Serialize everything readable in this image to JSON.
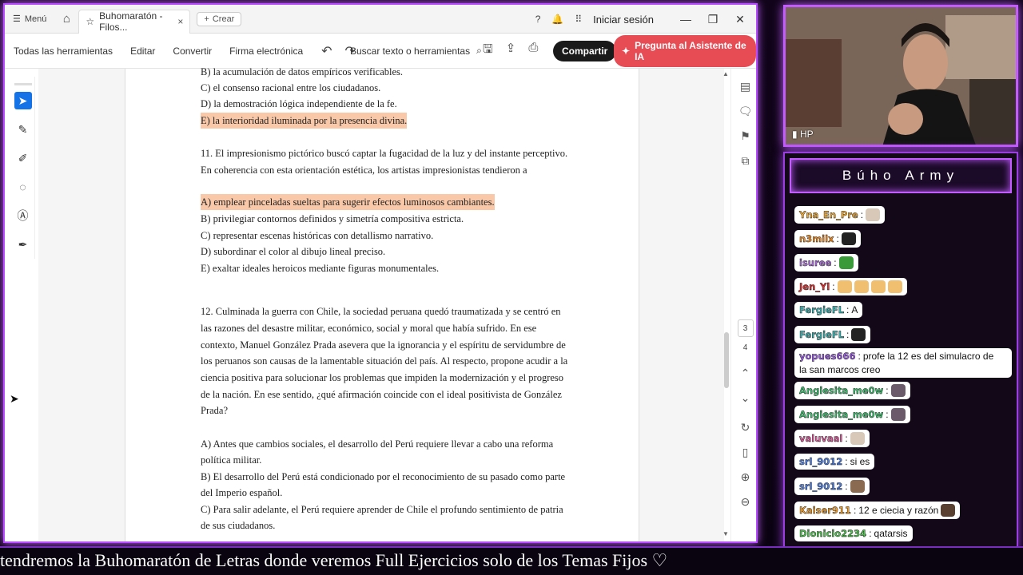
{
  "titlebar": {
    "menu_label": "Menú",
    "tab_label": "Buhomaratón - Filos...",
    "new_tab_label": "Crear",
    "signin_label": "Iniciar sesión"
  },
  "toolbar": {
    "all_tools": "Todas las herramientas",
    "edit": "Editar",
    "convert": "Convertir",
    "esign": "Firma electrónica",
    "search": "Buscar texto o herramientas",
    "share": "Compartir",
    "ai": "Pregunta al Asistente de IA"
  },
  "document": {
    "lines": [
      {
        "text": "B) la acumulación de datos empíricos verificables.",
        "highlight": false
      },
      {
        "text": "C) el consenso racional entre los ciudadanos.",
        "highlight": false
      },
      {
        "text": "D) la demostración lógica independiente de la fe.",
        "highlight": false
      },
      {
        "text": "E) la interioridad iluminada por la presencia divina.",
        "highlight": true
      },
      {
        "text": "11. El impresionismo pictórico buscó captar la fugacidad de la luz y del instante perceptivo.",
        "highlight": false
      },
      {
        "text": "En coherencia con esta orientación estética, los artistas impresionistas tendieron a",
        "highlight": false
      },
      {
        "text": "A) emplear pinceladas sueltas para sugerir efectos luminosos cambiantes.",
        "highlight": true
      },
      {
        "text": "B) privilegiar contornos definidos y simetría compositiva estricta.",
        "highlight": false
      },
      {
        "text": "C) representar escenas históricas con detallismo narrativo.",
        "highlight": false
      },
      {
        "text": "D) subordinar el color al dibujo lineal preciso.",
        "highlight": false
      },
      {
        "text": "E) exaltar ideales heroicos mediante figuras monumentales.",
        "highlight": false
      },
      {
        "text": "12. Culminada la guerra con Chile, la sociedad peruana quedó traumatizada y se centró en",
        "highlight": false
      },
      {
        "text": "las razones del desastre militar, económico, social y moral que había sufrido. En ese",
        "highlight": false
      },
      {
        "text": "contexto, Manuel González Prada asevera que la ignorancia y el espíritu de servidumbre de",
        "highlight": false
      },
      {
        "text": "los peruanos son causas de la lamentable situación del país. Al respecto, propone acudir a la",
        "highlight": false
      },
      {
        "text": "ciencia positiva para solucionar los problemas que impiden la modernización y el progreso",
        "highlight": false
      },
      {
        "text": "de la nación. En ese sentido, ¿qué afirmación coincide con el ideal positivista de González",
        "highlight": false
      },
      {
        "text": "Prada?",
        "highlight": false
      },
      {
        "text": "A) Antes que cambios sociales, el desarrollo del Perú requiere llevar a cabo una reforma",
        "highlight": false
      },
      {
        "text": "política militar.",
        "highlight": false
      },
      {
        "text": "B) El desarrollo del Perú está condicionado por el reconocimiento de su pasado como parte",
        "highlight": false
      },
      {
        "text": "del Imperio español.",
        "highlight": false
      },
      {
        "text": "C) Para salir adelante, el Perú requiere aprender de Chile el profundo sentimiento de patria",
        "highlight": false
      },
      {
        "text": "de sus ciudadanos.",
        "highlight": false
      }
    ]
  },
  "pager": {
    "current": "3",
    "next": "4"
  },
  "webcam": {
    "label": "HP"
  },
  "chat": {
    "title": "Búho Army",
    "messages": [
      {
        "user": "Yna_En_Pre",
        "text": "",
        "color": "#f0a830",
        "emotes": [
          "#d8c8b8"
        ]
      },
      {
        "user": "n3milx",
        "text": "",
        "color": "#f08a20",
        "emotes": [
          "#222222"
        ]
      },
      {
        "user": "isuree",
        "text": "",
        "color": "#b070e0",
        "emotes": [
          "#3a9a3a"
        ]
      },
      {
        "user": "Jen_Yl",
        "text": "",
        "color": "#e03030",
        "emotes": [
          "#f0c070",
          "#f0c070",
          "#f0c070",
          "#f0c070"
        ]
      },
      {
        "user": "FergieFL",
        "text": "A",
        "color": "#40b0b0",
        "emotes": []
      },
      {
        "user": "FergieFL",
        "text": "",
        "color": "#40b0b0",
        "emotes": [
          "#222222"
        ]
      },
      {
        "user": "yopues666",
        "text": "profe la 12 es del simulacro de",
        "text2": "la san marcos creo",
        "color": "#9a60e0",
        "emotes": []
      },
      {
        "user": "Angiesita_me0w",
        "text": "",
        "color": "#40c070",
        "emotes": [
          "#6a5a6a"
        ]
      },
      {
        "user": "Angiesita_me0w",
        "text": "",
        "color": "#40c070",
        "emotes": [
          "#6a5a6a"
        ]
      },
      {
        "user": "valuvaal",
        "text": "",
        "color": "#e060a0",
        "emotes": [
          "#d8c8b8"
        ]
      },
      {
        "user": "srl_9012",
        "text": "si es",
        "color": "#5080e0",
        "emotes": []
      },
      {
        "user": "srl_9012",
        "text": "",
        "color": "#5080e0",
        "emotes": [
          "#8a6a50"
        ]
      },
      {
        "user": "Kaiser911",
        "text": "12 e ciecia y razón",
        "color": "#f0a030",
        "emotes": [
          "#5a4030"
        ]
      },
      {
        "user": "Dionicio2234",
        "text": "qatarsis",
        "color": "#50c050",
        "emotes": []
      }
    ]
  },
  "ticker": {
    "text": "tendremos la Buhomaratón de Letras donde veremos Full Ejercicios solo de los Temas Fijos ♡"
  }
}
